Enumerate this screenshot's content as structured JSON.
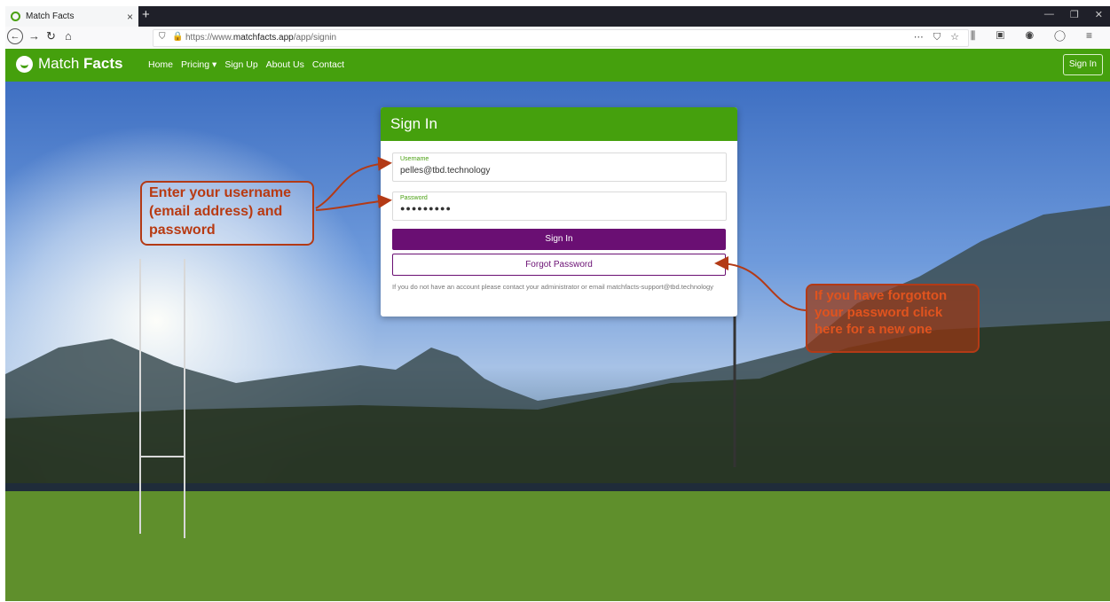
{
  "browser": {
    "tab_title": "Match Facts",
    "tab_close": "×",
    "new_tab": "+",
    "url_prefix": "https://www.",
    "url_domain": "matchfacts.app",
    "url_path": "/app/signin"
  },
  "site": {
    "brand_light": "Match ",
    "brand_bold": "Facts",
    "nav": [
      "Home",
      "Pricing ▾",
      "Sign Up",
      "About Us",
      "Contact"
    ],
    "signin_button": "Sign In"
  },
  "card": {
    "title": "Sign In",
    "username_label": "Username",
    "username_value": "pelles@tbd.technology",
    "password_label": "Password",
    "password_value": "●●●●●●●●●",
    "signin_button": "Sign In",
    "forgot_button": "Forgot Password",
    "note": "If you do not have an account please contact your administrator or email matchfacts-support@tbd.technology"
  },
  "annotations": {
    "callout_left": "Enter your username (email address) and password",
    "callout_right": "If you have forgotton your password click here for a new one"
  },
  "colors": {
    "brand_green": "#45a00d",
    "button_purple": "#6a0f73",
    "annotation_red": "#b33a16"
  }
}
